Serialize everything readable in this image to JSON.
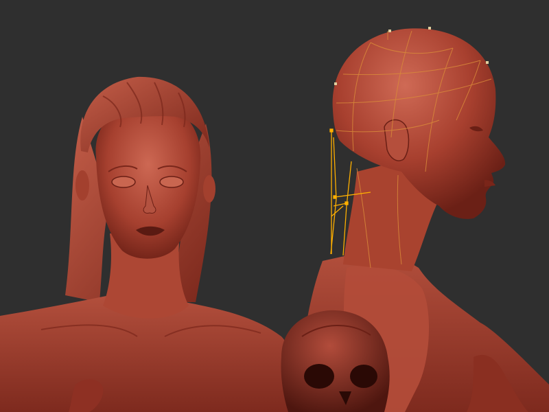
{
  "viewport": {
    "background_color": "#2f2f2f"
  },
  "palette": {
    "clay_base": "#9c3a2b",
    "clay_mid": "#b0493a",
    "clay_highlight": "#cf6a55",
    "clay_shadow": "#5a1a12",
    "wire_color": "#ffb000"
  },
  "objects": [
    {
      "name": "female-bust-with-hair",
      "icon": "sculpt-model-icon"
    },
    {
      "name": "bald-female-head-profile",
      "icon": "sculpt-model-icon"
    },
    {
      "name": "skull-prop",
      "icon": "skull-icon"
    },
    {
      "name": "zsphere-armature-wireframe",
      "icon": "wireframe-icon"
    }
  ]
}
